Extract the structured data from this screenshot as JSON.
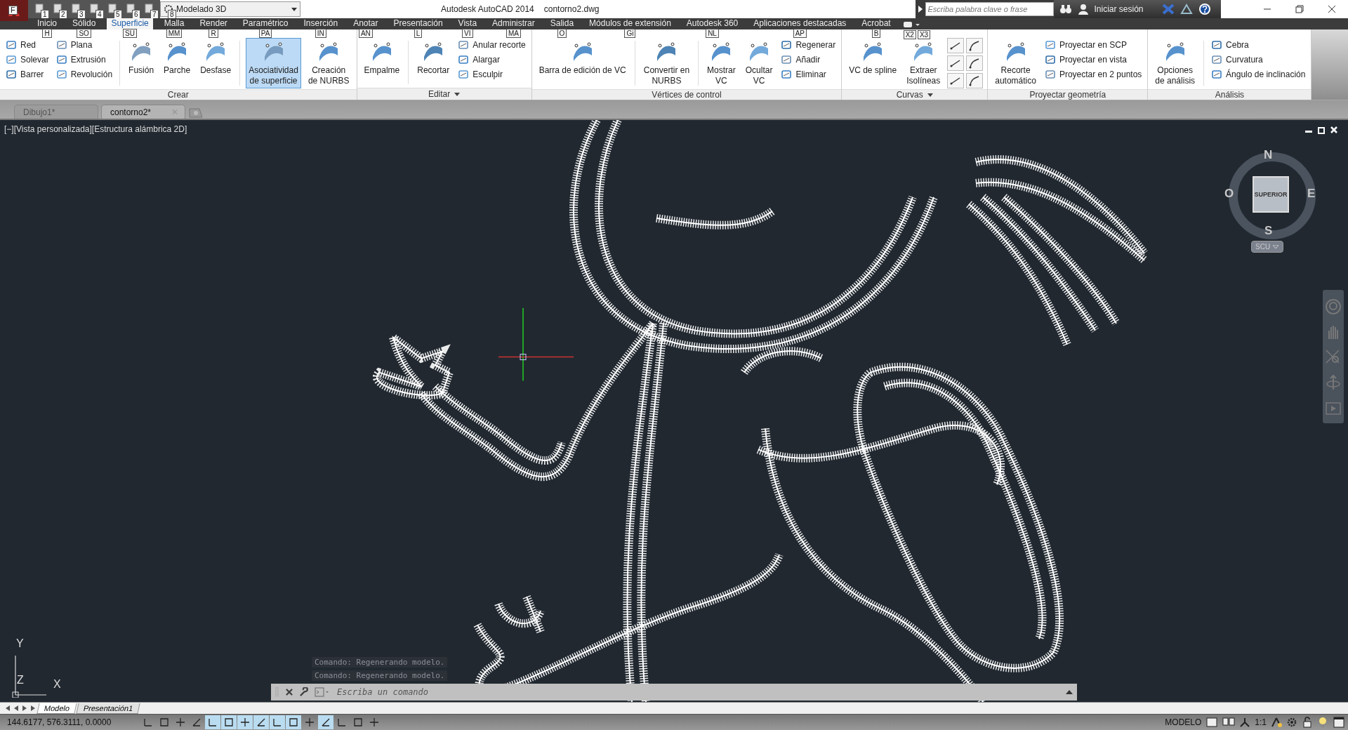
{
  "app_button": {
    "key_tip": "F"
  },
  "quick_access": [
    {
      "key_tip": "1"
    },
    {
      "key_tip": "2"
    },
    {
      "key_tip": "3"
    },
    {
      "key_tip": "4"
    },
    {
      "key_tip": "5"
    },
    {
      "key_tip": "6"
    },
    {
      "key_tip": "7"
    }
  ],
  "workspace": {
    "value": "Modelado 3D",
    "key_tip": "8"
  },
  "window": {
    "title": "Autodesk AutoCAD 2014",
    "file": "contorno2.dwg"
  },
  "search": {
    "placeholder": "Escriba palabra clave o frase"
  },
  "sign_in": "Iniciar sesión",
  "ribbon_tabs": [
    {
      "label": "Inicio",
      "key_tip": "H",
      "selected": false
    },
    {
      "label": "Sólido",
      "key_tip": "SO",
      "selected": false
    },
    {
      "label": "Superficie",
      "key_tip": "SU",
      "selected": true
    },
    {
      "label": "Malla",
      "key_tip": "MM",
      "selected": false
    },
    {
      "label": "Render",
      "key_tip": "R",
      "selected": false
    },
    {
      "label": "Paramétrico",
      "key_tip": "PA",
      "selected": false
    },
    {
      "label": "Inserción",
      "key_tip": "IN",
      "selected": false
    },
    {
      "label": "Anotar",
      "key_tip": "AN",
      "selected": false
    },
    {
      "label": "Presentación",
      "key_tip": "L",
      "selected": false
    },
    {
      "label": "Vista",
      "key_tip": "VI",
      "selected": false
    },
    {
      "label": "Administrar",
      "key_tip": "MA",
      "selected": false
    },
    {
      "label": "Salida",
      "key_tip": "O",
      "selected": false
    },
    {
      "label": "Módulos de extensión",
      "key_tip": "Gi",
      "selected": false
    },
    {
      "label": "Autodesk 360",
      "key_tip": "NL",
      "selected": false
    },
    {
      "label": "Aplicaciones destacadas",
      "key_tip": "AP",
      "selected": false
    },
    {
      "label": "Acrobat",
      "key_tip": "B",
      "selected": false
    }
  ],
  "extra_key_tips": [
    "X2",
    "X3"
  ],
  "ribbon_panels": [
    {
      "title": "Crear",
      "has_menu": false,
      "items": [
        {
          "kind": "small",
          "label": "Red"
        },
        {
          "kind": "small",
          "label": "Solevar"
        },
        {
          "kind": "small",
          "label": "Barrer"
        },
        {
          "kind": "small",
          "label": "Plana"
        },
        {
          "kind": "small",
          "label": "Extrusión"
        },
        {
          "kind": "small",
          "label": "Revolución"
        },
        {
          "kind": "separator"
        },
        {
          "kind": "large",
          "label": "Fusión",
          "selected": false
        },
        {
          "kind": "large",
          "label": "Parche",
          "selected": false
        },
        {
          "kind": "large",
          "label": "Desfase",
          "selected": false
        },
        {
          "kind": "separator"
        },
        {
          "kind": "large",
          "label": "Asociatividad\nde superficie",
          "selected": true
        },
        {
          "kind": "large",
          "label": "Creación\nde NURBS",
          "selected": false
        }
      ]
    },
    {
      "title": "Editar",
      "has_menu": true,
      "items": [
        {
          "kind": "large",
          "label": "Empalme",
          "selected": false
        },
        {
          "kind": "separator"
        },
        {
          "kind": "large",
          "label": "Recortar",
          "selected": false
        },
        {
          "kind": "small",
          "label": "Anular recorte"
        },
        {
          "kind": "small",
          "label": "Alargar"
        },
        {
          "kind": "small",
          "label": "Esculpir"
        }
      ]
    },
    {
      "title": "Vértices de control",
      "has_menu": false,
      "items": [
        {
          "kind": "large",
          "label": "Barra de edición de VC",
          "selected": false
        },
        {
          "kind": "separator"
        },
        {
          "kind": "large",
          "label": "Convertir en\nNURBS",
          "selected": false
        },
        {
          "kind": "separator"
        },
        {
          "kind": "large",
          "label": "Mostrar\nVC",
          "selected": false
        },
        {
          "kind": "large",
          "label": "Ocultar\nVC",
          "selected": false
        },
        {
          "kind": "small",
          "label": "Regenerar"
        },
        {
          "kind": "small",
          "label": "Añadir"
        },
        {
          "kind": "small",
          "label": "Eliminar"
        }
      ]
    },
    {
      "title": "Curvas",
      "has_menu": true,
      "items": [
        {
          "kind": "large",
          "label": "VC de spline",
          "selected": false
        },
        {
          "kind": "large",
          "label": "Extraer\nIsolíneas",
          "selected": false
        },
        {
          "kind": "icon_grid"
        }
      ]
    },
    {
      "title": "Proyectar geometría",
      "has_menu": false,
      "items": [
        {
          "kind": "large",
          "label": "Recorte\nautomático",
          "selected": false
        },
        {
          "kind": "small",
          "label": "Proyectar en SCP"
        },
        {
          "kind": "small",
          "label": "Proyectar en vista"
        },
        {
          "kind": "small",
          "label": "Proyectar en 2 puntos"
        }
      ]
    },
    {
      "title": "Análisis",
      "has_menu": false,
      "items": [
        {
          "kind": "large",
          "label": "Opciones\nde análisis",
          "selected": false
        },
        {
          "kind": "separator"
        },
        {
          "kind": "small",
          "label": "Cebra"
        },
        {
          "kind": "small",
          "label": "Curvatura"
        },
        {
          "kind": "small",
          "label": "Ángulo de inclinación"
        }
      ]
    }
  ],
  "doc_tabs": [
    {
      "label": "Dibujo1*",
      "selected": false
    },
    {
      "label": "contorno2*",
      "selected": true
    }
  ],
  "viewport_label": "[−][Vista personalizada][Estructura alámbrica 2D]",
  "viewcube": {
    "north": "N",
    "south": "S",
    "east": "E",
    "west": "O",
    "face": "SUPERIOR",
    "ucs": "SCU"
  },
  "ucs_icon": {
    "y": "Y",
    "z": "Z",
    "x": "X"
  },
  "command_history": [
    "Comando:  Regenerando modelo.",
    "Comando:  Regenerando modelo."
  ],
  "command_line": {
    "placeholder": "Escriba un comando"
  },
  "layout_tabs": [
    {
      "label": "Modelo",
      "selected": true
    },
    {
      "label": "Presentación1",
      "selected": false
    }
  ],
  "status_bar": {
    "coordinates": "144.6177, 576.3111, 0.0000",
    "toggles": [
      {
        "on": false
      },
      {
        "on": false
      },
      {
        "on": false
      },
      {
        "on": false
      },
      {
        "on": true
      },
      {
        "on": true
      },
      {
        "on": true
      },
      {
        "on": true
      },
      {
        "on": true
      },
      {
        "on": true
      },
      {
        "on": false
      },
      {
        "on": true
      },
      {
        "on": false
      },
      {
        "on": false
      },
      {
        "on": false
      }
    ],
    "space": "MODELO",
    "scale": "1:1"
  }
}
